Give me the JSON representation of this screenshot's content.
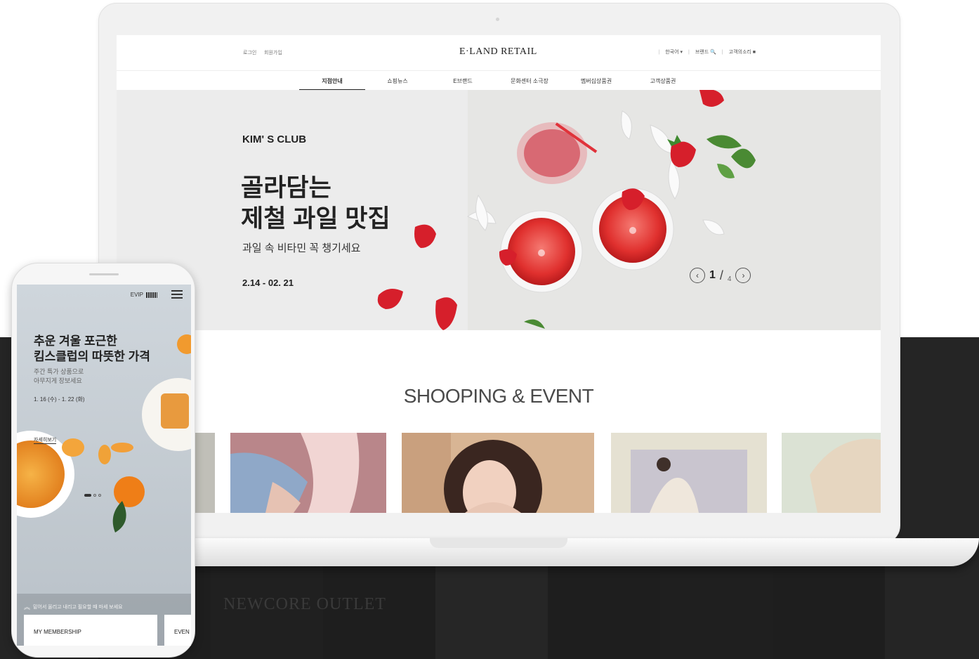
{
  "site": {
    "logo": "E·LAND RETAIL",
    "util_left": [
      "로그인",
      "회원가입"
    ],
    "util_right": [
      "한국어 ▾",
      "브랜드 🔍",
      "고객의소리 ■"
    ]
  },
  "nav": {
    "items": [
      "지점안내",
      "쇼핑뉴스",
      "E브랜드",
      "문화센터 소극장",
      "멤버십상품권",
      "고객상품권"
    ],
    "active": "지점안내"
  },
  "hero": {
    "subtitle": "KIM' S CLUB",
    "title": "골라담는\n제철 과일 맛집",
    "description": "과일 속 비타민 꼭 챙기세요",
    "date": "2.14 - 02. 21",
    "page_current": "1",
    "page_total": "4",
    "prev_icon": "chevron-left-circle-icon",
    "next_icon": "chevron-right-circle-icon"
  },
  "section": {
    "title": "SHOOPING & EVENT"
  },
  "phone": {
    "evip": "EVIP",
    "title": "추운 겨울 포근한\n킴스클럽의 따뜻한 가격",
    "description": "주간 특가 상품으로\n아무지게 장보세요",
    "date": "1. 16 (수) - 1. 22 (화)",
    "more": "자세히보기",
    "scroll_hint": "밑어서 올리고 내리고 필요할 때 마세 보세요",
    "card_1": "MY MEMBERSHIP",
    "card_2": "EVEN"
  },
  "background": {
    "logos": [
      "NEWCORE OUTLET"
    ]
  },
  "colors": {
    "dark_band": "#1e1e1e",
    "hero_bg": "#ececec",
    "accent_red": "#d9262e"
  }
}
